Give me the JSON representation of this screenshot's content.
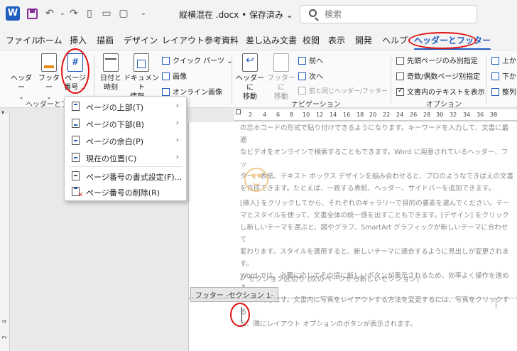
{
  "window": {
    "doc_title": "縦横混在 .docx • 保存済み ⌄",
    "search_placeholder": "検索"
  },
  "tabs": [
    {
      "label": "ファイル"
    },
    {
      "label": "ホーム"
    },
    {
      "label": "挿入"
    },
    {
      "label": "描画"
    },
    {
      "label": "デザイン"
    },
    {
      "label": "レイアウト"
    },
    {
      "label": "参考資料"
    },
    {
      "label": "差し込み文書"
    },
    {
      "label": "校閲"
    },
    {
      "label": "表示"
    },
    {
      "label": "開発"
    },
    {
      "label": "ヘルプ"
    },
    {
      "label": "ヘッダーとフッター"
    }
  ],
  "ribbon": {
    "header_btn": "ヘッダー",
    "footer_btn": "フッター",
    "page_number_btn_1": "ページ",
    "page_number_btn_2": "番号 ⌄",
    "date_time_1": "日付と",
    "date_time_2": "時刻",
    "doc_info_1": "ドキュメント",
    "doc_info_2": "情報 ⌄",
    "quick_parts": "クイック パーツ ⌄",
    "picture": "画像",
    "online_picture": "オンライン画像",
    "goto_header_1": "ヘッダーに",
    "goto_header_2": "移動",
    "goto_footer_1": "フッターに",
    "goto_footer_2": "移動",
    "prev": "前へ",
    "next": "次へ",
    "link_prev": "前と同じヘッダー/フッター",
    "nav_group": "ナビゲーション",
    "opt_first": "先頭ページのみ別指定",
    "opt_oddeven": "奇数/偶数ページ別指定",
    "opt_show_text": "文書内のテキストを表示",
    "options_group": "オプション",
    "hf_group": "ヘッダーとフッ",
    "pos_top": "上から",
    "pos_bottom": "下から",
    "align": "整列"
  },
  "options_state": {
    "first": false,
    "oddeven": false,
    "show_text": true
  },
  "menu": {
    "items": [
      {
        "label": "ページの上部(T)"
      },
      {
        "label": "ページの下部(B)"
      },
      {
        "label": "ページの余白(P)"
      },
      {
        "label": "現在の位置(C)"
      },
      {
        "label": "ページ番号の書式設定(F)..."
      },
      {
        "label": "ページ番号の削除(R)"
      }
    ]
  },
  "ruler": {
    "h_ticks": [
      "2",
      "4",
      "6",
      "8",
      "10",
      "12",
      "14",
      "16",
      "18",
      "20",
      "22",
      "24",
      "26",
      "28",
      "30",
      "32",
      "34",
      "36",
      "38"
    ],
    "v_ticks": [
      "2",
      "4"
    ]
  },
  "document": {
    "p1_line1": "の忘ホコードの形式で貼り付けできるようになります。キーワードを入力して、文書に最適",
    "p1_line2": "なビデオをオンラインで検索することもできます。Word に用意されているヘッダー、フッ",
    "p1_line3": "ター、表紙、テキスト ボックス デザインを組み合わせると、プロのようなできばえの文書",
    "p1_line4": "を作成できます。たとえば、一致する表紙、ヘッダー、サイドバーを追加できます。",
    "p2_line1": "[挿入] をクリックしてから、それぞれのギャラリーで目的の要素を選んでください。テー",
    "p2_line2": "マとスタイルを使って、文書全体の統一感を出すこともできます。[デザイン] をクリック",
    "p2_line3": "し新しいテーマを選ぶと、図やグラフ、SmartArt グラフィックが新しいテーマに合わせて",
    "p2_line4": "変わります。スタイルを適用すると、新しいテーマに適合するように見出しが変更されます。",
    "p2_line5": "Word では、必要に応じてその場に新しいボタンが表示されるため、効率よく操作を進める",
    "p2_line6": "ことができます。文書内に写真をレイアウトする方法を変更するには、写真をクリックする",
    "p2_line7": "と、隣にレイアウト オプションのボタンが表示されます。",
    "section_break": "↵ セクション区切り (次のページから新しいセクション)",
    "footer_label": "フッター -セクション 1-"
  },
  "colors": {
    "accent": "#1f5cc0",
    "highlight": "#e01010"
  }
}
